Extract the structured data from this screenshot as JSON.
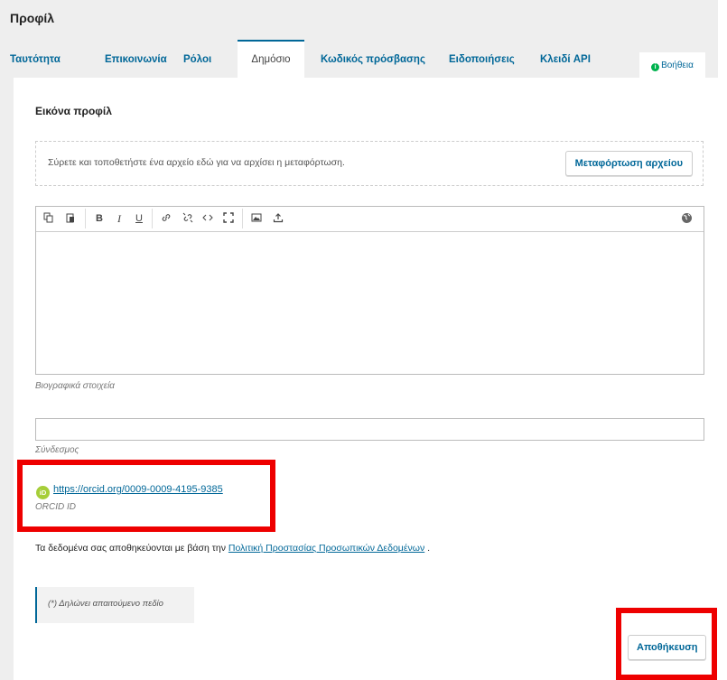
{
  "page": {
    "title": "Προφίλ"
  },
  "tabs": [
    {
      "label": "Ταυτότητα"
    },
    {
      "label": "Επικοινωνία"
    },
    {
      "label": "Ρόλοι"
    },
    {
      "label": "Δημόσιο"
    },
    {
      "label": "Κωδικός πρόσβασης"
    },
    {
      "label": "Ειδοποιήσεις"
    },
    {
      "label": "Κλειδί API"
    }
  ],
  "active_tab": "Δημόσιο",
  "help": {
    "label": "Βοήθεια"
  },
  "profile_image": {
    "label": "Εικόνα προφίλ",
    "dropzone_text": "Σύρετε και τοποθετήστε ένα αρχείο εδώ για να αρχίσει η μεταφόρτωση.",
    "upload_button": "Μεταφόρτωση αρχείου"
  },
  "bio": {
    "hint": "Βιογραφικά στοιχεία",
    "value": ""
  },
  "link": {
    "hint": "Σύνδεσμος",
    "value": ""
  },
  "orcid": {
    "badge": "iD",
    "url": "https://orcid.org/0009-0009-4195-9385",
    "hint": "ORCID ID"
  },
  "privacy": {
    "prefix": "Τα δεδομένα σας αποθηκεύονται με βάση την",
    "link": "Πολιτική Προστασίας Προσωπικών Δεδομένων",
    "suffix": "."
  },
  "required_note": "(*) Δηλώνει απαιτούμενο πεδίο",
  "save_button": "Αποθήκευση",
  "colors": {
    "link": "#006798",
    "highlight": "#ee0000",
    "orcid": "#a6ce39"
  }
}
